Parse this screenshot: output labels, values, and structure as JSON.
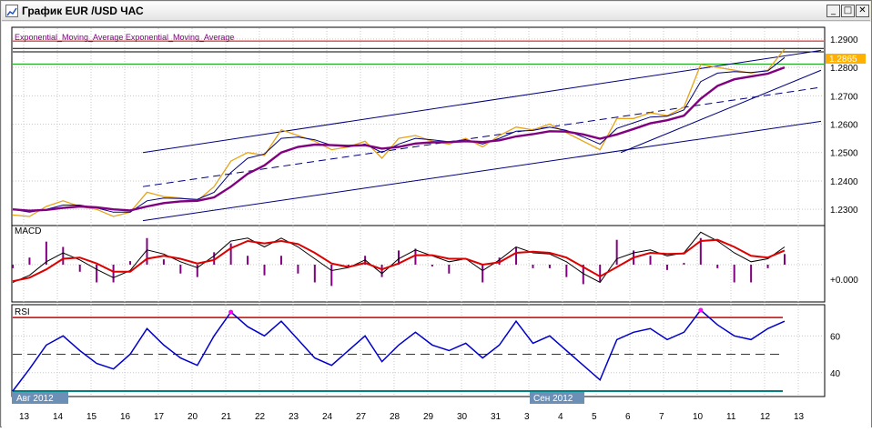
{
  "window": {
    "title": "График EUR /USD  ЧАС",
    "minimize_label": "_",
    "maximize_label": "□",
    "close_label": "✕"
  },
  "colors": {
    "price": "#e8a317",
    "ema_fast": "#000080",
    "ema_slow": "#800080",
    "channel": "#000080",
    "resistance": "#cc0000",
    "support": "#00a000",
    "macd_signal": "#dd0000",
    "histogram": "#800080",
    "rsi": "#0000cc",
    "rsi_overbought": "#ff00ff",
    "last_price_bg": "#ffb000"
  },
  "main_panel": {
    "legend": "Exponential_Moving_Average  Exponential_Moving_Average",
    "last_price": "1.2865"
  },
  "macd_panel": {
    "label": "MACD",
    "zero_label": "+0.000"
  },
  "rsi_panel": {
    "label": "RSI"
  },
  "time_axis": {
    "month_labels": [
      {
        "text": "Авг 2012",
        "at": 13
      },
      {
        "text": "Сен 2012",
        "at": 3
      }
    ]
  },
  "chart_data": [
    {
      "type": "line",
      "title": "EUR/USD",
      "x_ticks": [
        "13",
        "14",
        "15",
        "16",
        "17",
        "20",
        "21",
        "22",
        "23",
        "24",
        "27",
        "28",
        "29",
        "30",
        "31",
        "3",
        "4",
        "5",
        "6",
        "7",
        "10",
        "11",
        "12",
        "13"
      ],
      "y_ticks": [
        "1.2300",
        "1.2400",
        "1.2500",
        "1.2600",
        "1.2700",
        "1.2800",
        "1.2900"
      ],
      "ylim": [
        1.223,
        1.2935
      ],
      "levels": {
        "resistance_1": 1.2893,
        "resistance_2": 1.2867,
        "resistance_3": 1.2855,
        "support": 1.2812
      },
      "series": [
        {
          "name": "Exponential_Moving_Average",
          "role": "price",
          "values": [
            1.228,
            1.2275,
            1.231,
            1.233,
            1.231,
            1.23,
            1.2275,
            1.229,
            1.236,
            1.2345,
            1.234,
            1.233,
            1.238,
            1.247,
            1.25,
            1.249,
            1.258,
            1.256,
            1.254,
            1.251,
            1.252,
            1.254,
            1.248,
            1.255,
            1.256,
            1.254,
            1.253,
            1.255,
            1.252,
            1.256,
            1.259,
            1.258,
            1.26,
            1.257,
            1.254,
            1.251,
            1.262,
            1.262,
            1.264,
            1.263,
            1.266,
            1.281,
            1.28,
            1.279,
            1.278,
            1.279,
            1.2865
          ]
        },
        {
          "name": "Exponential_Moving_Average",
          "role": "ema_fast",
          "values": [
            1.23,
            1.229,
            1.23,
            1.2315,
            1.2315,
            1.2305,
            1.229,
            1.229,
            1.233,
            1.234,
            1.2338,
            1.2335,
            1.236,
            1.243,
            1.248,
            1.2495,
            1.255,
            1.2555,
            1.2545,
            1.2525,
            1.252,
            1.253,
            1.25,
            1.253,
            1.255,
            1.2545,
            1.2538,
            1.2545,
            1.253,
            1.255,
            1.2575,
            1.2578,
            1.259,
            1.2578,
            1.2555,
            1.253,
            1.2585,
            1.2605,
            1.2625,
            1.2628,
            1.265,
            1.275,
            1.278,
            1.2785,
            1.2782,
            1.2788,
            1.2835
          ]
        },
        {
          "name": "Exponential_Moving_Average",
          "role": "ema_slow",
          "values": [
            1.23,
            1.2295,
            1.2298,
            1.2305,
            1.231,
            1.2307,
            1.23,
            1.2296,
            1.231,
            1.2322,
            1.2328,
            1.233,
            1.2342,
            1.238,
            1.2425,
            1.2455,
            1.25,
            1.252,
            1.2528,
            1.2526,
            1.2524,
            1.2526,
            1.2514,
            1.252,
            1.2532,
            1.2536,
            1.2537,
            1.254,
            1.2537,
            1.2543,
            1.2557,
            1.2565,
            1.2575,
            1.2574,
            1.2564,
            1.2549,
            1.2564,
            1.2583,
            1.2603,
            1.2614,
            1.263,
            1.269,
            1.2735,
            1.2758,
            1.2768,
            1.2778,
            1.28
          ]
        }
      ]
    },
    {
      "type": "line",
      "title": "MACD",
      "ylim": [
        -0.006,
        0.006
      ],
      "series": [
        {
          "name": "MACD",
          "values": [
            -0.003,
            -0.0018,
            0.0005,
            0.002,
            0.0008,
            -0.0008,
            -0.0022,
            -0.001,
            0.0025,
            0.0018,
            0.0005,
            -0.0005,
            0.0015,
            0.004,
            0.0045,
            0.003,
            0.0045,
            0.003,
            0.001,
            -0.001,
            -0.0005,
            0.0008,
            -0.0015,
            0.001,
            0.0025,
            0.0015,
            0.0005,
            0.001,
            -0.001,
            0.0008,
            0.003,
            0.002,
            0.0018,
            0.0005,
            -0.0015,
            -0.003,
            0.001,
            0.002,
            0.0025,
            0.0015,
            0.002,
            0.0055,
            0.004,
            0.002,
            0.0005,
            0.001,
            0.003
          ]
        },
        {
          "name": "Signal",
          "values": [
            -0.0028,
            -0.0022,
            -0.0008,
            0.001,
            0.0012,
            0.0002,
            -0.0012,
            -0.0012,
            0.001,
            0.0015,
            0.001,
            0.0002,
            0.0008,
            0.0028,
            0.004,
            0.0036,
            0.004,
            0.0035,
            0.002,
            0.0002,
            -0.0004,
            0.0003,
            -0.0008,
            0.0002,
            0.0016,
            0.0016,
            0.001,
            0.001,
            0.0,
            0.0004,
            0.002,
            0.0022,
            0.002,
            0.0012,
            -0.0004,
            -0.002,
            -0.0004,
            0.0012,
            0.002,
            0.0018,
            0.0019,
            0.004,
            0.0042,
            0.003,
            0.0015,
            0.0012,
            0.0024
          ]
        }
      ]
    },
    {
      "type": "line",
      "title": "RSI",
      "y_ticks": [
        "40",
        "60"
      ],
      "ylim": [
        28,
        76
      ],
      "levels": {
        "overbought": 70,
        "mid": 50,
        "oversold": 30
      },
      "series": [
        {
          "name": "RSI",
          "values": [
            30,
            42,
            55,
            60,
            52,
            45,
            42,
            50,
            64,
            55,
            48,
            44,
            60,
            73,
            65,
            60,
            68,
            58,
            48,
            44,
            52,
            60,
            46,
            55,
            62,
            55,
            52,
            56,
            48,
            55,
            68,
            56,
            60,
            52,
            44,
            36,
            58,
            62,
            64,
            58,
            62,
            74,
            66,
            60,
            58,
            64,
            68
          ]
        }
      ]
    }
  ]
}
